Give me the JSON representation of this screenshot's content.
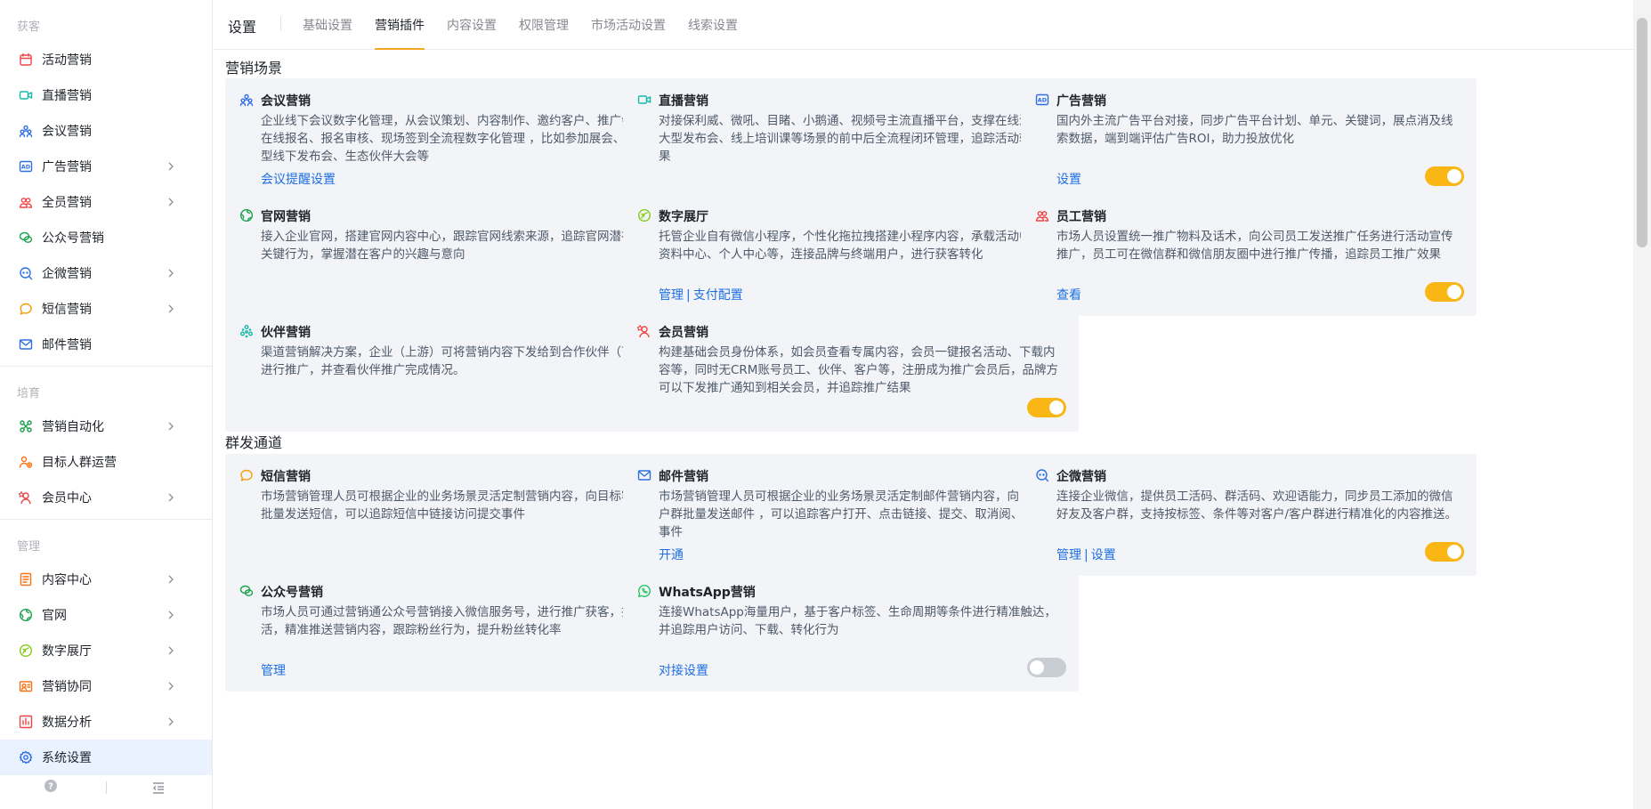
{
  "sidebar": {
    "groups": [
      {
        "title": "获客",
        "items": [
          {
            "label": "活动营销",
            "icon": "calendar-icon",
            "expand": false
          },
          {
            "label": "直播营销",
            "icon": "video-icon",
            "expand": false
          },
          {
            "label": "会议营销",
            "icon": "people-icon",
            "expand": false
          },
          {
            "label": "广告营销",
            "icon": "ad-icon",
            "expand": true
          },
          {
            "label": "全员营销",
            "icon": "team-icon",
            "expand": true
          },
          {
            "label": "公众号营销",
            "icon": "wechat-icon",
            "expand": false
          },
          {
            "label": "企微营销",
            "icon": "wecom-icon",
            "expand": true
          },
          {
            "label": "短信营销",
            "icon": "chat-bubble-icon",
            "expand": true
          },
          {
            "label": "邮件营销",
            "icon": "mail-icon",
            "expand": false
          }
        ]
      },
      {
        "title": "培育",
        "items": [
          {
            "label": "营销自动化",
            "icon": "automation-icon",
            "expand": true
          },
          {
            "label": "目标人群运营",
            "icon": "target-people-icon",
            "expand": false
          },
          {
            "label": "会员中心",
            "icon": "member-icon",
            "expand": true
          }
        ]
      },
      {
        "title": "管理",
        "items": [
          {
            "label": "内容中心",
            "icon": "content-icon",
            "expand": true
          },
          {
            "label": "官网",
            "icon": "globe-icon",
            "expand": true
          },
          {
            "label": "数字展厅",
            "icon": "showroom-icon",
            "expand": true
          },
          {
            "label": "营销协同",
            "icon": "collab-icon",
            "expand": true
          },
          {
            "label": "数据分析",
            "icon": "chart-icon",
            "expand": true
          },
          {
            "label": "系统设置",
            "icon": "gear-icon",
            "expand": false,
            "active": true
          }
        ]
      }
    ]
  },
  "header": {
    "title": "设置",
    "tabs": [
      "基础设置",
      "营销插件",
      "内容设置",
      "权限管理",
      "市场活动设置",
      "线索设置"
    ],
    "active_tab": 1
  },
  "sections": [
    {
      "title": "营销场景",
      "cards": [
        {
          "title": "会议营销",
          "icon": "people-icon",
          "icon_color": "#2f6fe4",
          "desc": "企业线下会议数字化管理，从会议策划、内容制作、邀约客户、推广会议、在线报名、报名审核、现场签到全流程数字化管理 ，比如参加展会、自办大型线下发布会、生态伙伴大会等",
          "links": [
            "会议提醒设置"
          ],
          "toggle": "on"
        },
        {
          "title": "直播营销",
          "icon": "video-icon",
          "icon_color": "#14b8a6",
          "desc": "对接保利威、微吼、目睹、小鹅通、视频号主流直播平台，支撑在线沙龙、大型发布会、线上培训课等场景的前中后全流程闭环管理，追踪活动转化效果",
          "links": [],
          "toggle": "on"
        },
        {
          "title": "广告营销",
          "icon": "ad-icon",
          "icon_color": "#2f6fe4",
          "desc": "国内外主流广告平台对接，同步广告平台计划、单元、关键词，展点消及线索数据，端到端评估广告ROI，助力投放优化",
          "links": [
            "设置"
          ],
          "toggle": "on"
        },
        {
          "title": "官网营销",
          "icon": "globe-icon",
          "icon_color": "#16a34a",
          "desc": "接入企业官网，搭建官网内容中心，跟踪官网线索来源，追踪官网潜在客户关键行为，掌握潜在客户的兴趣与意向",
          "links": [],
          "toggle": "on"
        },
        {
          "title": "数字展厅",
          "icon": "showroom-icon",
          "icon_color": "#84cc16",
          "desc": "托管企业自有微信小程序，个性化拖拉拽搭建小程序内容，承载活动中心、资料中心、个人中心等，连接品牌与终端用户，进行获客转化",
          "links": [
            "管理",
            "支付配置"
          ],
          "toggle": "on"
        },
        {
          "title": "员工营销",
          "icon": "team-icon",
          "icon_color": "#ef4444",
          "desc": "市场人员设置统一推广物料及话术，向公司员工发送推广任务进行活动宣传推广，员工可在微信群和微信朋友圈中进行推广传播，追踪员工推广效果",
          "links": [
            "查看"
          ],
          "toggle": "on"
        },
        {
          "title": "伙伴营销",
          "icon": "partner-icon",
          "icon_color": "#14b8a6",
          "desc": "渠道营销解决方案，企业（上游）可将营销内容下发给到合作伙伴（下游）进行推广，并查看伙伴推广完成情况。",
          "links": [],
          "toggle": "disabled"
        },
        {
          "title": "会员营销",
          "icon": "member-icon",
          "icon_color": "#ef4444",
          "desc": "构建基础会员身份体系，如会员查看专属内容，会员一键报名活动、下载内容等，同时无CRM账号员工、伙伴、客户等，注册成为推广会员后，品牌方可以下发推广通知到相关会员，并追踪推广结果",
          "links": [],
          "toggle": "on"
        }
      ]
    },
    {
      "title": "群发通道",
      "cards": [
        {
          "title": "短信营销",
          "icon": "chat-bubble-icon",
          "icon_color": "#f59e0b",
          "desc": "市场营销管理人员可根据企业的业务场景灵活定制营销内容，向目标客户群批量发送短信，可以追踪短信中链接访问提交事件",
          "links": [],
          "toggle": "on"
        },
        {
          "title": "邮件营销",
          "icon": "mail-icon",
          "icon_color": "#2f6fe4",
          "desc": "市场营销管理人员可根据企业的业务场景灵活定制邮件营销内容，向目标客户群批量发送邮件 ，可以追踪客户打开、点击链接、提交、取消阅、投诉等事件",
          "links": [
            "开通"
          ],
          "toggle": "on"
        },
        {
          "title": "企微营销",
          "icon": "wecom-icon",
          "icon_color": "#2f6fe4",
          "desc": "连接企业微信，提供员工活码、群活码、欢迎语能力，同步员工添加的微信好友及客户群，支持按标签、条件等对客户/客户群进行精准化的内容推送。",
          "links": [
            "管理",
            "设置"
          ],
          "toggle": "on"
        },
        {
          "title": "公众号营销",
          "icon": "wechat-icon",
          "icon_color": "#16a34a",
          "desc": "市场人员可通过营销通公众号营销接入微信服务号，进行推广获客，拉新促活，精准推送营销内容，跟踪粉丝行为，提升粉丝转化率",
          "links": [
            "管理"
          ],
          "toggle": "on"
        },
        {
          "title": "WhatsApp营销",
          "icon": "whatsapp-icon",
          "icon_color": "#22c55e",
          "desc": "连接WhatsApp海量用户，基于客户标签、生命周期等条件进行精准触达，并追踪用户访问、下载、转化行为",
          "links": [
            "对接设置"
          ],
          "toggle": "off"
        }
      ]
    }
  ]
}
